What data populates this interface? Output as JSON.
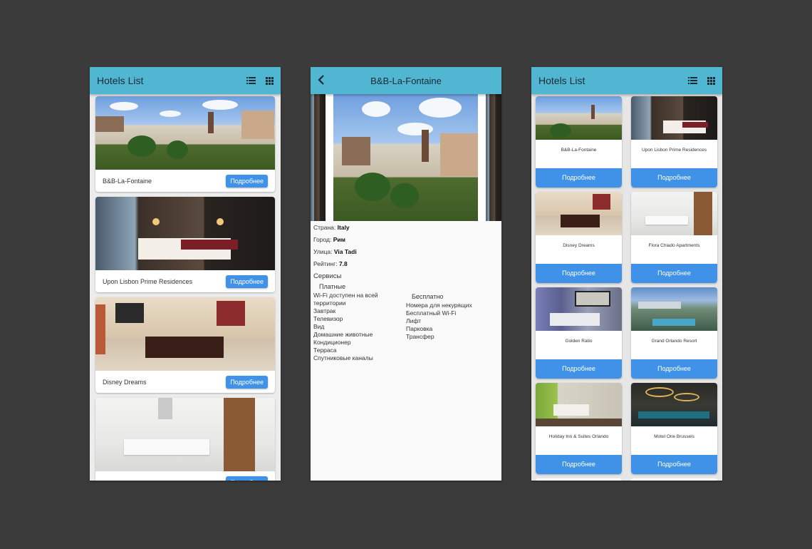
{
  "screens": {
    "list": {
      "title": "Hotels List",
      "icons": [
        "list-view-icon",
        "grid-view-icon"
      ],
      "button_label": "Подробнее",
      "hotels": [
        {
          "name": "B&B-La-Fontaine",
          "photo": "square"
        },
        {
          "name": "Upon Lisbon Prime Residences",
          "photo": "bedroom"
        },
        {
          "name": "Disney Dreams",
          "photo": "dining"
        },
        {
          "name": "",
          "photo": "kitchen"
        }
      ]
    },
    "detail": {
      "title": "B&B-La-Fontaine",
      "country_label": "Страна:",
      "country": "Italy",
      "city_label": "Город:",
      "city": "Рим",
      "street_label": "Улица:",
      "street": "Via Tadi",
      "rating_label": "Рейтинг:",
      "rating": "7.8",
      "services_label": "Сервисы",
      "paid_label": "Платные",
      "paid": [
        "Wi-Fi доступен на всей территории",
        "Завтрак",
        "Телевизор",
        "Вид",
        "Домашние животные",
        "Кондиционер",
        "Терраса",
        "Спутниковые каналы"
      ],
      "free_label": "Бесплатно",
      "free": [
        "Номера для некурящих",
        "Бесплатный Wi-Fi",
        "Лифт",
        "Парковка",
        "Трансфер"
      ]
    },
    "grid": {
      "title": "Hotels List",
      "button_label": "Подробнее",
      "hotels": [
        {
          "name": "B&B-La-Fontaine",
          "photo": "square"
        },
        {
          "name": "Upon Lisbon Prime Residences",
          "photo": "bedroom"
        },
        {
          "name": "Disney Dreams",
          "photo": "dining"
        },
        {
          "name": "Flora Chiado Apartments",
          "photo": "kitchen"
        },
        {
          "name": "Golden Ratio",
          "photo": "golden"
        },
        {
          "name": "Grand Orlando Resort",
          "photo": "orlando"
        },
        {
          "name": "Holiday Inn & Suites Orlando",
          "photo": "holiday"
        },
        {
          "name": "Motel One Brussels",
          "photo": "motel"
        }
      ]
    }
  },
  "colors": {
    "appbar": "#51b6d2",
    "button": "#3f92e8",
    "background": "#3b3b3b"
  }
}
